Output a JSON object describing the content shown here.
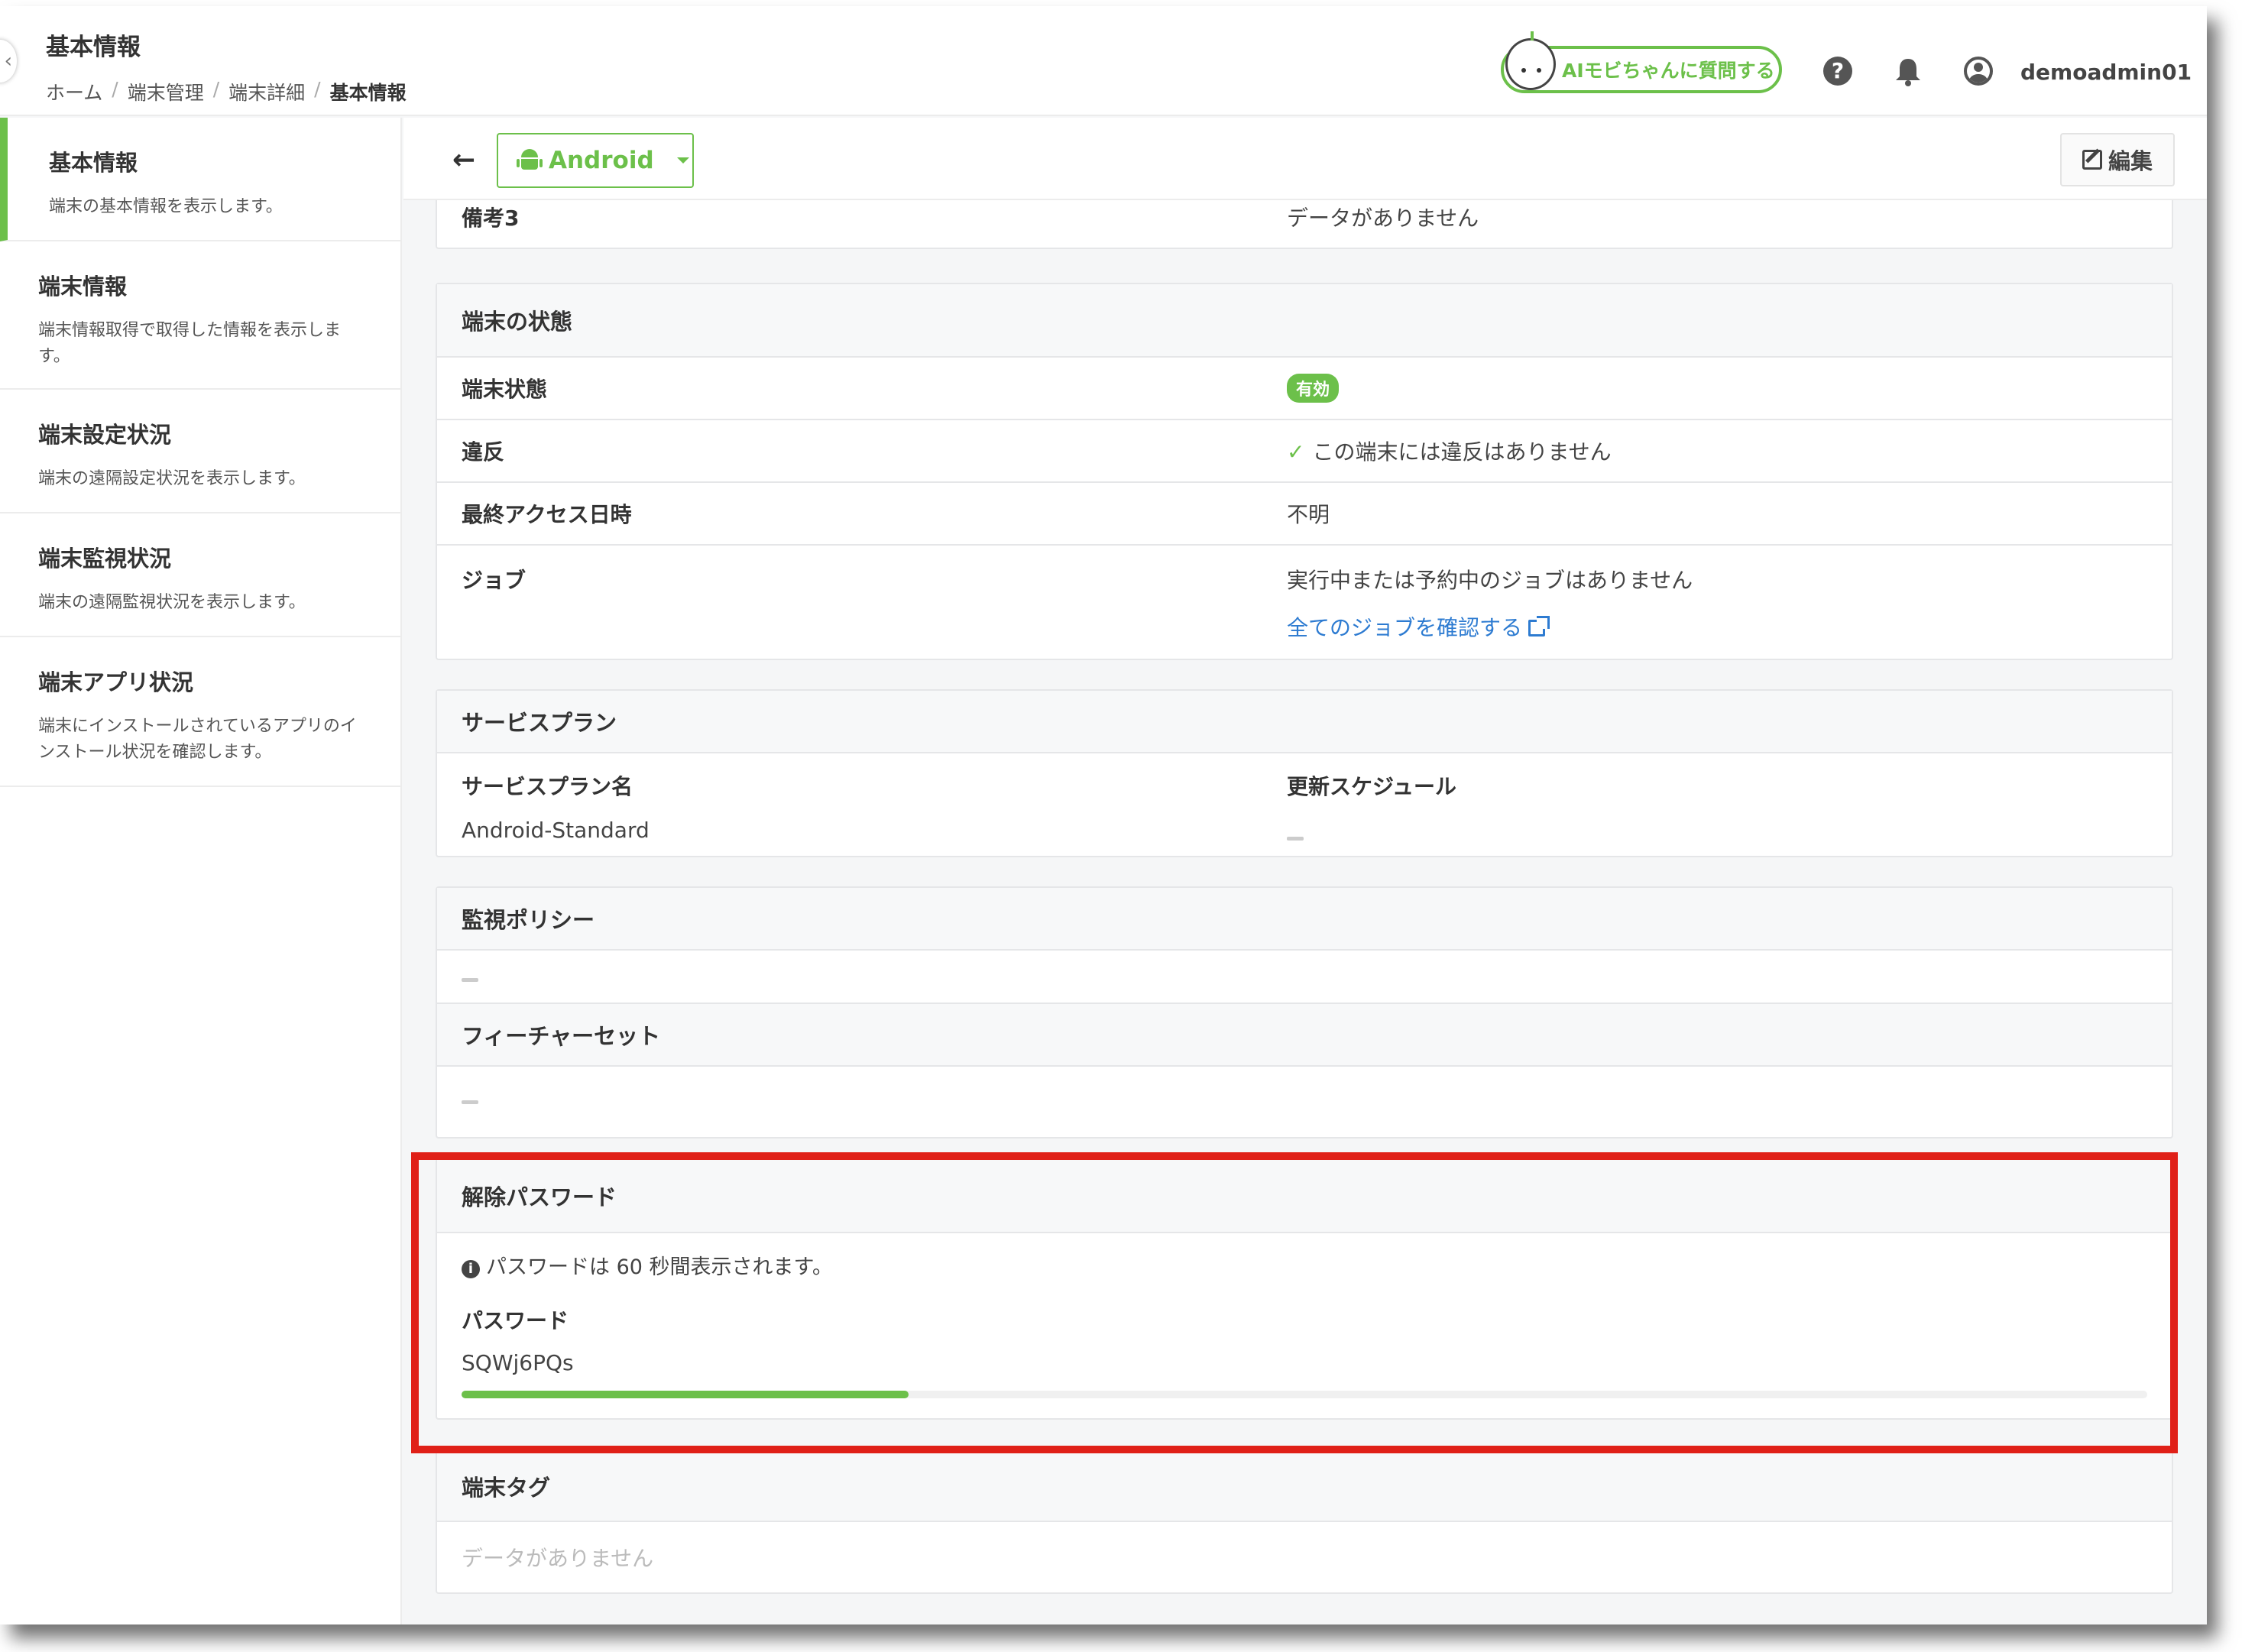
{
  "header": {
    "page_title": "基本情報",
    "breadcrumb": [
      "ホーム",
      "端末管理",
      "端末詳細",
      "基本情報"
    ],
    "ai_button_label": "AIモビちゃんに質問する",
    "help_icon": "question-circle-icon",
    "bell_icon": "bell-icon",
    "user_icon": "user-circle-icon",
    "username": "demoadmin01"
  },
  "sidebar": {
    "items": [
      {
        "title": "基本情報",
        "desc": "端末の基本情報を表示します。",
        "active": true
      },
      {
        "title": "端末情報",
        "desc": "端末情報取得で取得した情報を表示します。",
        "active": false
      },
      {
        "title": "端末設定状況",
        "desc": "端末の遠隔設定状況を表示します。",
        "active": false
      },
      {
        "title": "端末監視状況",
        "desc": "端末の遠隔監視状況を表示します。",
        "active": false
      },
      {
        "title": "端末アプリ状況",
        "desc": "端末にインストールされているアプリのインストール状況を確認します。",
        "active": false
      }
    ]
  },
  "toolbar": {
    "os_label": "Android",
    "edit_label": "編集"
  },
  "remarks": {
    "label": "備考3",
    "value": "データがありません"
  },
  "status": {
    "title": "端末の状態",
    "device_status_label": "端末状態",
    "device_status_value": "有効",
    "violation_label": "違反",
    "violation_value": "この端末には違反はありません",
    "last_access_label": "最終アクセス日時",
    "last_access_value": "不明",
    "job_label": "ジョブ",
    "job_value": "実行中または予約中のジョブはありません",
    "job_link": "全てのジョブを確認する"
  },
  "service_plan": {
    "title": "サービスプラン",
    "name_label": "サービスプラン名",
    "name_value": "Android-Standard",
    "schedule_label": "更新スケジュール"
  },
  "monitoring_policy": {
    "title": "監視ポリシー"
  },
  "feature_set": {
    "title": "フィーチャーセット"
  },
  "unlock_password": {
    "title": "解除パスワード",
    "notice": "パスワードは 60 秒間表示されます。",
    "password_label": "パスワード",
    "password_value": "SQWj6PQs",
    "progress_fraction": 0.265
  },
  "tags": {
    "title": "端末タグ",
    "value": "データがありません"
  },
  "colors": {
    "accent": "#6cc04a",
    "link": "#2d7bd1",
    "highlight": "#e02018"
  }
}
